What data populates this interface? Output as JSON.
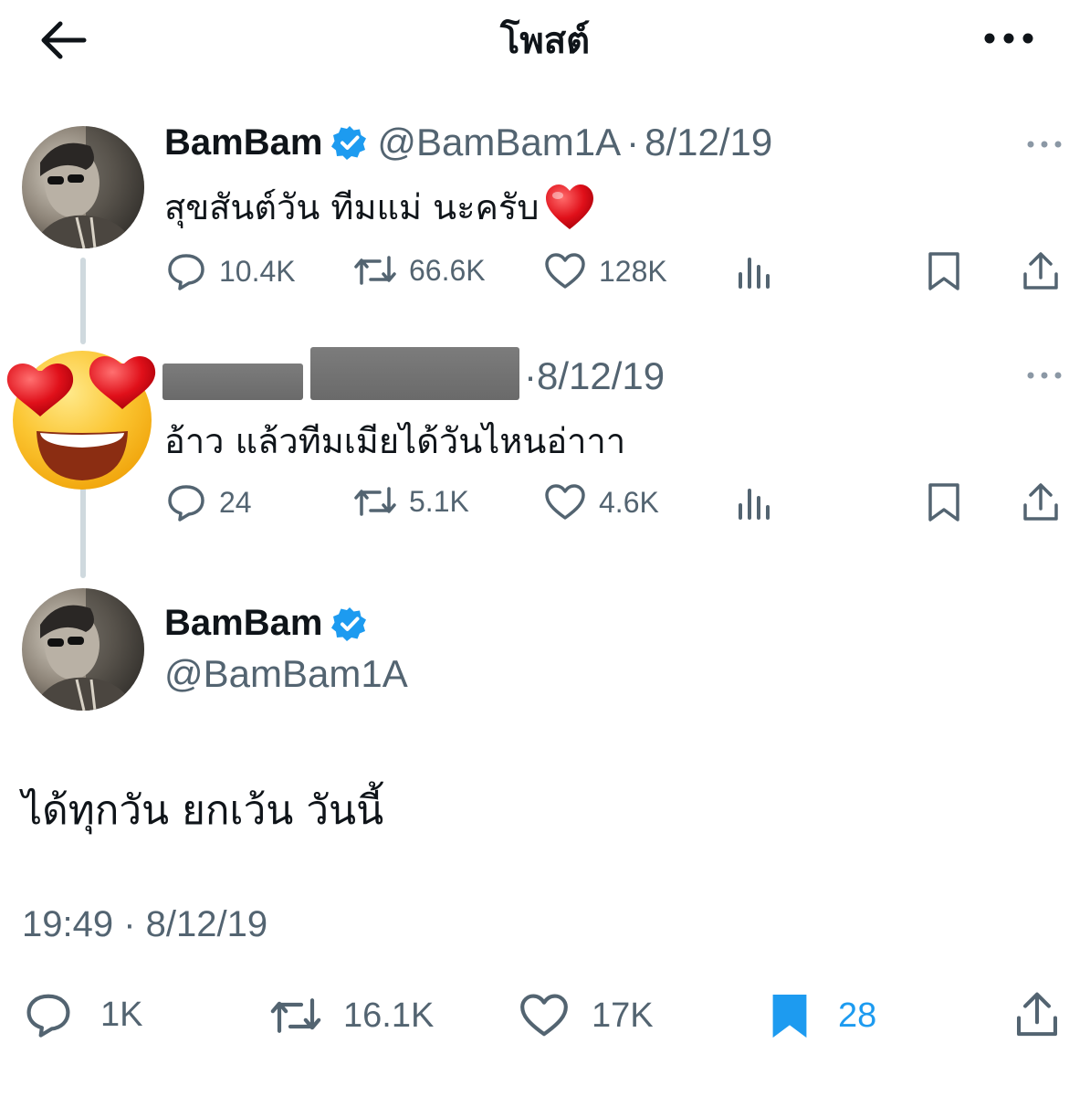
{
  "header": {
    "title": "โพสต์",
    "back_icon": "arrow-left-icon",
    "more_icon": "more-horizontal-icon"
  },
  "colors": {
    "verified": "#1d9bf0",
    "bookmark_active": "#1d9bf0",
    "muted": "#536471",
    "text": "#0f1419"
  },
  "thread": [
    {
      "name": "BamBam",
      "handle": "@BamBam1A",
      "date": "8/12/19",
      "text": "สุขสันต์วัน ทีมแม่ นะครับ",
      "emoji": "❤️",
      "stats": {
        "replies": "10.4K",
        "reposts": "66.6K",
        "likes": "128K"
      }
    },
    {
      "date": "8/12/19",
      "text": "อ้าว แล้วทีมเมียได้วันไหนอ่าาา",
      "stats": {
        "replies": "24",
        "reposts": "5.1K",
        "likes": "4.6K"
      }
    }
  ],
  "main": {
    "name": "BamBam",
    "handle": "@BamBam1A",
    "text": "ได้ทุกวัน ยกเว้น วันนี้",
    "timestamp": "19:49 · 8/12/19",
    "stats": {
      "replies": "1K",
      "reposts": "16.1K",
      "likes": "17K",
      "bookmarks": "28"
    }
  }
}
